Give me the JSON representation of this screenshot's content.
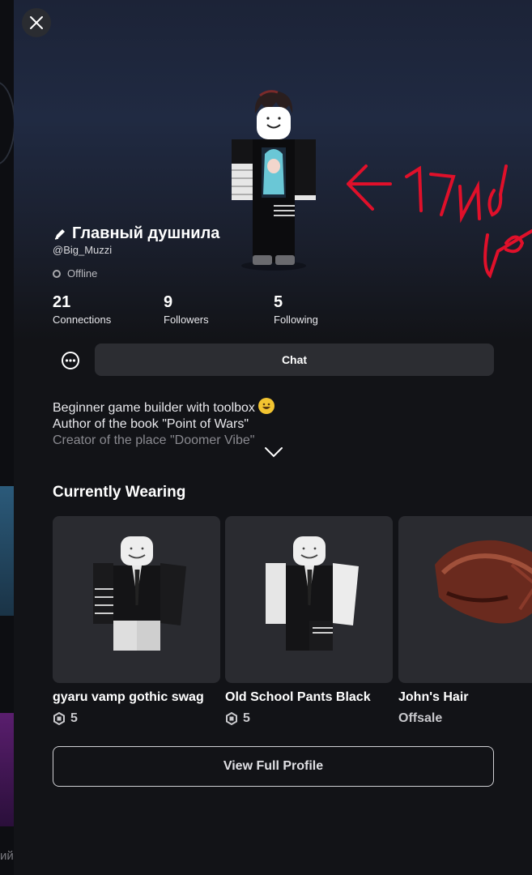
{
  "profile": {
    "display_name": "Главный душнила",
    "username": "@Big_Muzzi",
    "status": "Offline"
  },
  "annotation": {
    "handwriting": "← 17идор"
  },
  "stats": [
    {
      "value": "21",
      "label": "Connections"
    },
    {
      "value": "9",
      "label": "Followers"
    },
    {
      "value": "5",
      "label": "Following"
    }
  ],
  "actions": {
    "chat_label": "Chat",
    "view_full_profile_label": "View Full Profile"
  },
  "bio": {
    "line1": "Beginner game builder with toolbox",
    "line2": "Author of the book \"Point of Wars\"",
    "line3": "Creator of the place \"Doomer Vibe\""
  },
  "wearing": {
    "title": "Currently Wearing",
    "items": [
      {
        "name": "gyaru vamp gothic swag",
        "price": "5"
      },
      {
        "name": "Old School Pants Black",
        "price": "5"
      },
      {
        "name": "John's Hair",
        "price": "Offsale"
      }
    ]
  },
  "background_text": "ий",
  "icons": [
    "close-icon",
    "pencil-icon",
    "status-offline-icon",
    "more-icon",
    "chevron-down-icon",
    "robux-icon",
    "smile-emoji-icon"
  ],
  "colors": {
    "sheet_bg": "#121317",
    "button_bg": "#2c2d32",
    "card_bg": "#2a2b30",
    "annotation_red": "#e0102a"
  }
}
